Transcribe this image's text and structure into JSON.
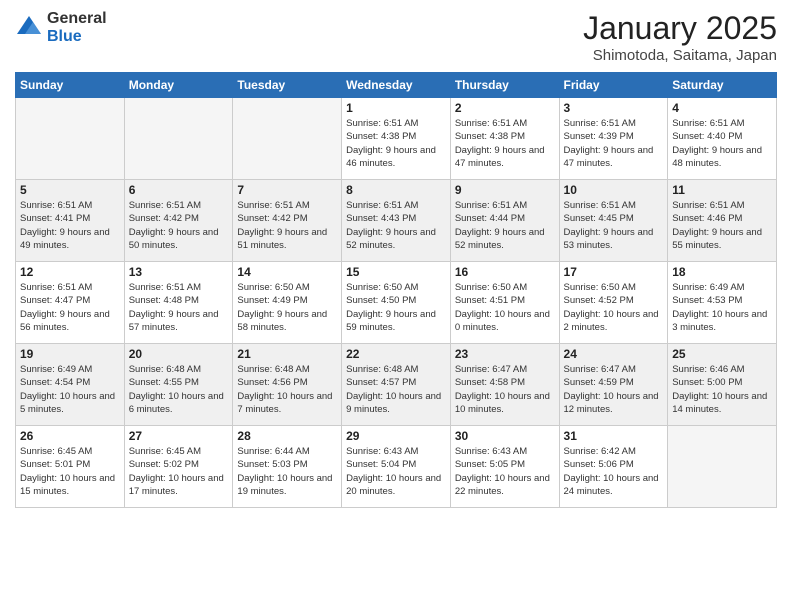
{
  "logo": {
    "general": "General",
    "blue": "Blue"
  },
  "header": {
    "month": "January 2025",
    "location": "Shimotoda, Saitama, Japan"
  },
  "days_of_week": [
    "Sunday",
    "Monday",
    "Tuesday",
    "Wednesday",
    "Thursday",
    "Friday",
    "Saturday"
  ],
  "weeks": [
    [
      {
        "day": "",
        "info": ""
      },
      {
        "day": "",
        "info": ""
      },
      {
        "day": "",
        "info": ""
      },
      {
        "day": "1",
        "info": "Sunrise: 6:51 AM\nSunset: 4:38 PM\nDaylight: 9 hours\nand 46 minutes."
      },
      {
        "day": "2",
        "info": "Sunrise: 6:51 AM\nSunset: 4:38 PM\nDaylight: 9 hours\nand 47 minutes."
      },
      {
        "day": "3",
        "info": "Sunrise: 6:51 AM\nSunset: 4:39 PM\nDaylight: 9 hours\nand 47 minutes."
      },
      {
        "day": "4",
        "info": "Sunrise: 6:51 AM\nSunset: 4:40 PM\nDaylight: 9 hours\nand 48 minutes."
      }
    ],
    [
      {
        "day": "5",
        "info": "Sunrise: 6:51 AM\nSunset: 4:41 PM\nDaylight: 9 hours\nand 49 minutes."
      },
      {
        "day": "6",
        "info": "Sunrise: 6:51 AM\nSunset: 4:42 PM\nDaylight: 9 hours\nand 50 minutes."
      },
      {
        "day": "7",
        "info": "Sunrise: 6:51 AM\nSunset: 4:42 PM\nDaylight: 9 hours\nand 51 minutes."
      },
      {
        "day": "8",
        "info": "Sunrise: 6:51 AM\nSunset: 4:43 PM\nDaylight: 9 hours\nand 52 minutes."
      },
      {
        "day": "9",
        "info": "Sunrise: 6:51 AM\nSunset: 4:44 PM\nDaylight: 9 hours\nand 52 minutes."
      },
      {
        "day": "10",
        "info": "Sunrise: 6:51 AM\nSunset: 4:45 PM\nDaylight: 9 hours\nand 53 minutes."
      },
      {
        "day": "11",
        "info": "Sunrise: 6:51 AM\nSunset: 4:46 PM\nDaylight: 9 hours\nand 55 minutes."
      }
    ],
    [
      {
        "day": "12",
        "info": "Sunrise: 6:51 AM\nSunset: 4:47 PM\nDaylight: 9 hours\nand 56 minutes."
      },
      {
        "day": "13",
        "info": "Sunrise: 6:51 AM\nSunset: 4:48 PM\nDaylight: 9 hours\nand 57 minutes."
      },
      {
        "day": "14",
        "info": "Sunrise: 6:50 AM\nSunset: 4:49 PM\nDaylight: 9 hours\nand 58 minutes."
      },
      {
        "day": "15",
        "info": "Sunrise: 6:50 AM\nSunset: 4:50 PM\nDaylight: 9 hours\nand 59 minutes."
      },
      {
        "day": "16",
        "info": "Sunrise: 6:50 AM\nSunset: 4:51 PM\nDaylight: 10 hours\nand 0 minutes."
      },
      {
        "day": "17",
        "info": "Sunrise: 6:50 AM\nSunset: 4:52 PM\nDaylight: 10 hours\nand 2 minutes."
      },
      {
        "day": "18",
        "info": "Sunrise: 6:49 AM\nSunset: 4:53 PM\nDaylight: 10 hours\nand 3 minutes."
      }
    ],
    [
      {
        "day": "19",
        "info": "Sunrise: 6:49 AM\nSunset: 4:54 PM\nDaylight: 10 hours\nand 5 minutes."
      },
      {
        "day": "20",
        "info": "Sunrise: 6:48 AM\nSunset: 4:55 PM\nDaylight: 10 hours\nand 6 minutes."
      },
      {
        "day": "21",
        "info": "Sunrise: 6:48 AM\nSunset: 4:56 PM\nDaylight: 10 hours\nand 7 minutes."
      },
      {
        "day": "22",
        "info": "Sunrise: 6:48 AM\nSunset: 4:57 PM\nDaylight: 10 hours\nand 9 minutes."
      },
      {
        "day": "23",
        "info": "Sunrise: 6:47 AM\nSunset: 4:58 PM\nDaylight: 10 hours\nand 10 minutes."
      },
      {
        "day": "24",
        "info": "Sunrise: 6:47 AM\nSunset: 4:59 PM\nDaylight: 10 hours\nand 12 minutes."
      },
      {
        "day": "25",
        "info": "Sunrise: 6:46 AM\nSunset: 5:00 PM\nDaylight: 10 hours\nand 14 minutes."
      }
    ],
    [
      {
        "day": "26",
        "info": "Sunrise: 6:45 AM\nSunset: 5:01 PM\nDaylight: 10 hours\nand 15 minutes."
      },
      {
        "day": "27",
        "info": "Sunrise: 6:45 AM\nSunset: 5:02 PM\nDaylight: 10 hours\nand 17 minutes."
      },
      {
        "day": "28",
        "info": "Sunrise: 6:44 AM\nSunset: 5:03 PM\nDaylight: 10 hours\nand 19 minutes."
      },
      {
        "day": "29",
        "info": "Sunrise: 6:43 AM\nSunset: 5:04 PM\nDaylight: 10 hours\nand 20 minutes."
      },
      {
        "day": "30",
        "info": "Sunrise: 6:43 AM\nSunset: 5:05 PM\nDaylight: 10 hours\nand 22 minutes."
      },
      {
        "day": "31",
        "info": "Sunrise: 6:42 AM\nSunset: 5:06 PM\nDaylight: 10 hours\nand 24 minutes."
      },
      {
        "day": "",
        "info": ""
      }
    ]
  ]
}
